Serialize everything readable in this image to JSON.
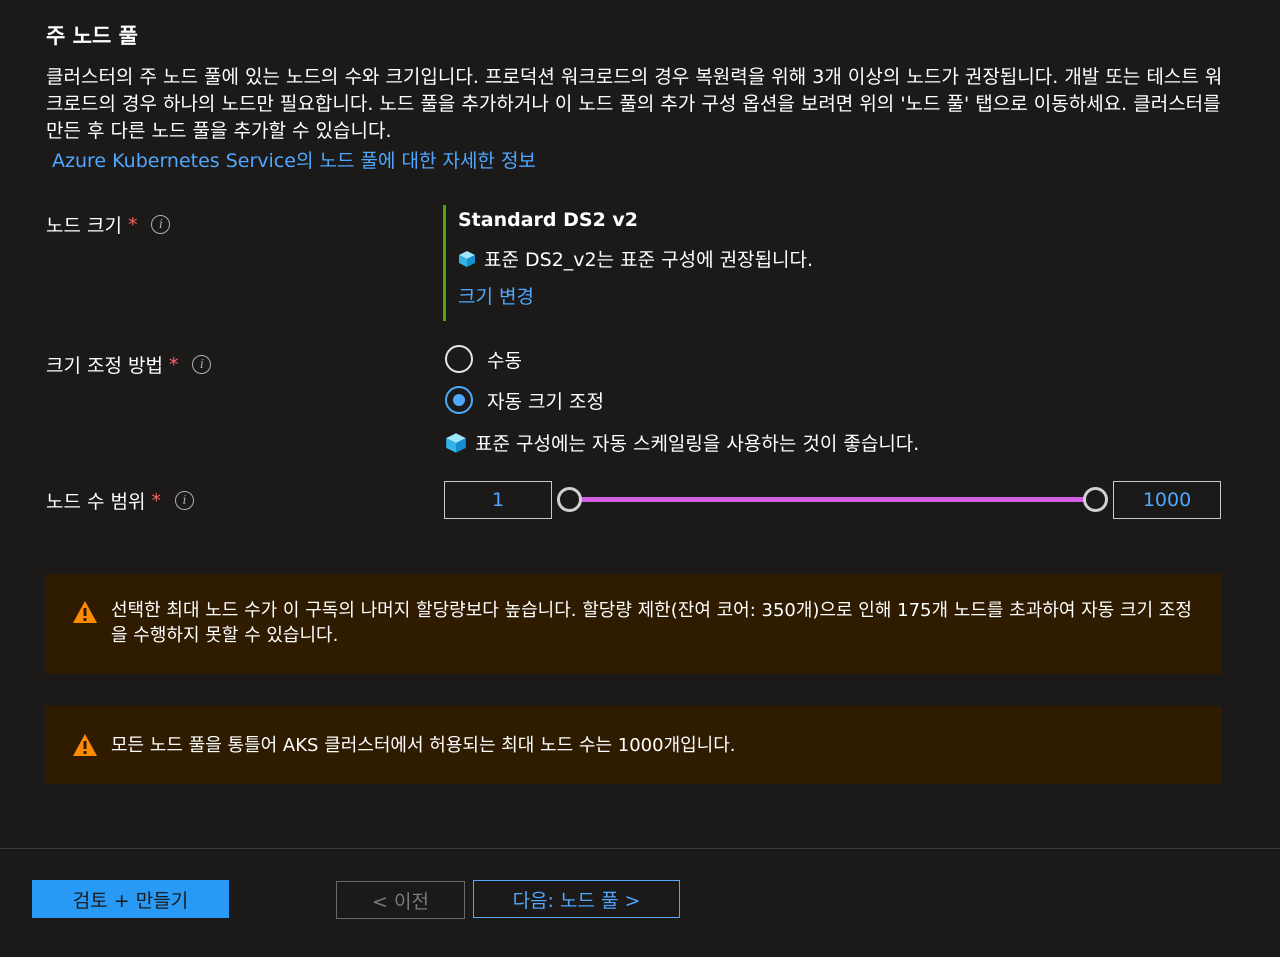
{
  "section": {
    "title": "주 노드 풀",
    "description": "클러스터의 주 노드 풀에 있는 노드의 수와 크기입니다. 프로덕션 워크로드의 경우 복원력을 위해 3개 이상의 노드가 권장됩니다. 개발 또는 테스트 워크로드의 경우 하나의 노드만 필요합니다. 노드 풀을 추가하거나 이 노드 풀의 추가 구성 옵션을 보려면 위의 '노드 풀' 탭으로 이동하세요. 클러스터를 만든 후 다른 노드 풀을 추가할 수 있습니다.",
    "learn_more_link": "Azure Kubernetes Service의 노드 풀에 대한 자세한 정보"
  },
  "node_size": {
    "label": "노드 크기",
    "required_mark": "*",
    "value": "Standard DS2 v2",
    "recommendation": "표준 DS2_v2는 표준 구성에 권장됩니다.",
    "change_link": "크기 변경"
  },
  "scale_method": {
    "label": "크기 조정 방법",
    "required_mark": "*",
    "options": [
      "수동",
      "자동 크기 조정"
    ],
    "selected": "자동 크기 조정",
    "hint": "표준 구성에는 자동 스케일링을 사용하는 것이 좋습니다."
  },
  "node_count_range": {
    "label": "노드 수 범위",
    "required_mark": "*",
    "min": "1",
    "max": "1000",
    "slider_color": "#d35ee6"
  },
  "warnings": [
    {
      "text": "선택한 최대 노드 수가 이 구독의 나머지 할당량보다 높습니다. 할당량 제한(잔여 코어: 350개)으로 인해 175개 노드를 초과하여 자동 크기 조정을 수행하지 못할 수 있습니다."
    },
    {
      "text": "모든 노드 풀을 통틀어 AKS 클러스터에서 허용되는 최대 노드 수는 1000개입니다."
    }
  ],
  "footer": {
    "review_create": "검토 + 만들기",
    "previous": "< 이전",
    "next": "다음: 노드 풀 >"
  },
  "icons": {
    "info": "info-icon",
    "cube": "cube-icon",
    "warning": "warning-icon"
  },
  "colors": {
    "background": "#1b1a19",
    "link": "#4fa7ff",
    "primary_button": "#2899f5",
    "warning_bg": "#2e1b00",
    "warning_icon": "#ff8c00",
    "size_accent": "#57a300"
  }
}
